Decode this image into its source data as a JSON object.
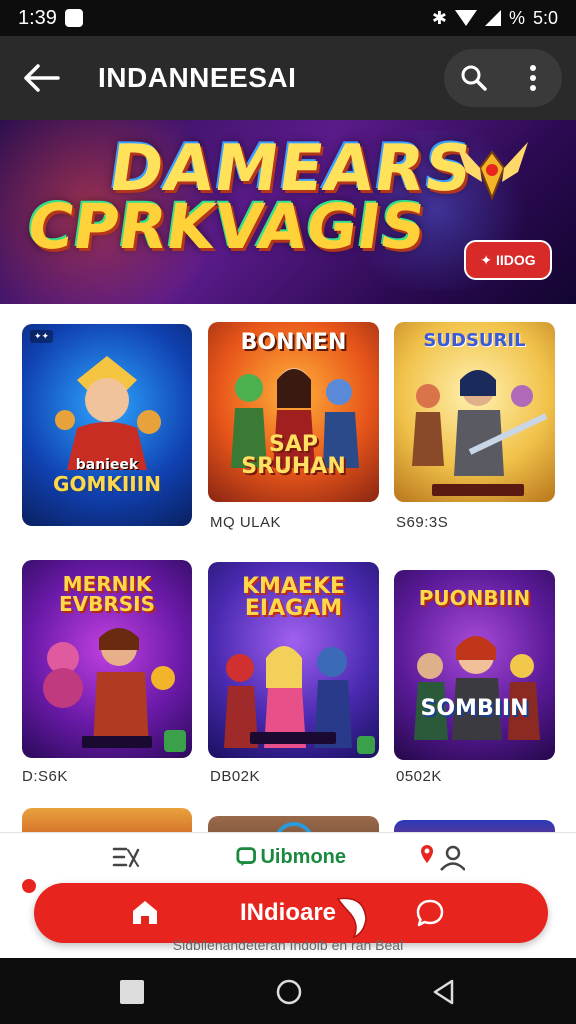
{
  "status_bar": {
    "time": "1:39",
    "battery": "5:0"
  },
  "app_bar": {
    "title": "INDANNEESAI"
  },
  "banner": {
    "line1": "DAMEARS",
    "line2": "CPRKVAGIS",
    "badge": "IIDOG"
  },
  "games": [
    {
      "title": "GOMKIIIN",
      "subtitle": "banieek",
      "caption": ""
    },
    {
      "title": "BONNEN",
      "subtitle": "SAP SRUHAN",
      "caption": "MQ ULAK"
    },
    {
      "title": "SUDSURIL",
      "subtitle": "",
      "caption": "S69:3S"
    },
    {
      "title": "MERNIK EVBRSIS",
      "subtitle": "",
      "caption": "D:S6K"
    },
    {
      "title": "KMAEKE EIAGAM",
      "subtitle": "",
      "caption": "DB02K"
    },
    {
      "title": "PUONBIIN",
      "subtitle": "SOMBIIN",
      "caption": "0502K"
    }
  ],
  "bottom_nav": {
    "center_label": "Uibmone",
    "pill_label": "INdioare",
    "footer": "Sidbilenandeteran Indoib en ran Beal"
  },
  "colors": {
    "accent": "#e8241f",
    "appbar": "#2a2a2a",
    "green": "#1a8a3e"
  }
}
